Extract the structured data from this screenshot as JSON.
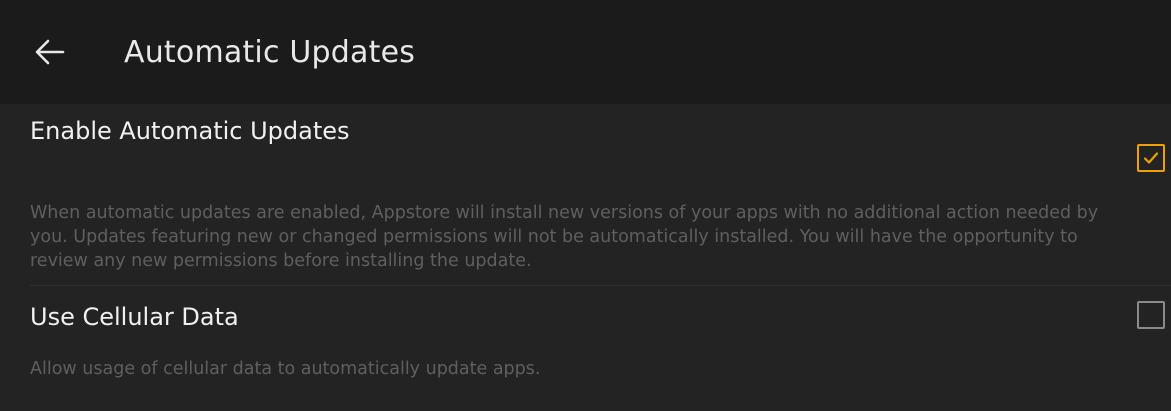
{
  "header": {
    "back_icon": "arrow-left-icon",
    "title": "Automatic Updates"
  },
  "settings": [
    {
      "title": "Enable Automatic Updates",
      "description": "When automatic updates are enabled, Appstore will install new versions of your apps with no additional action needed by you. Updates featuring new or changed permissions will not be automatically installed. You will have the opportunity to review any new permissions before installing the update.",
      "checked": true
    },
    {
      "title": "Use Cellular Data",
      "description": "Allow usage of cellular data to automatically update apps.",
      "checked": false
    }
  ],
  "colors": {
    "accent": "#f0a000",
    "background": "#232323",
    "header_background": "#1b1b1b"
  }
}
